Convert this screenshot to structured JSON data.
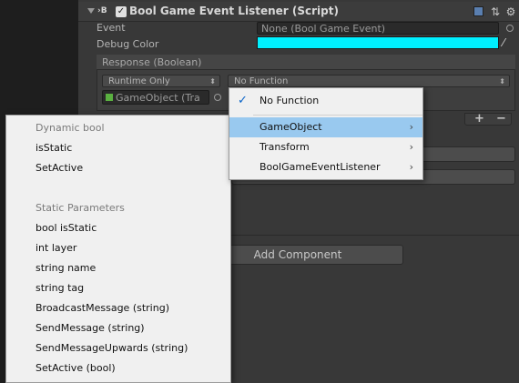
{
  "component": {
    "title": "Bool Game Event Listener (Script)",
    "enabled_mark": "✓",
    "script_icon_text": "›B"
  },
  "fields": {
    "event_label": "Event",
    "event_value": "None (Bool Game Event)",
    "debug_color_label": "Debug Color",
    "debug_color_value": "#00f0ff"
  },
  "response": {
    "title": "Response (Boolean)",
    "runtime_mode": "Runtime Only",
    "function": "No Function",
    "target_object": "GameObject (Tra",
    "plus": "+",
    "minus": "−"
  },
  "add_component_label": "Add Component",
  "right_menu": {
    "items": [
      {
        "label": "No Function",
        "checked": true,
        "has_submenu": false
      },
      {
        "label": "GameObject",
        "checked": false,
        "has_submenu": true,
        "highlighted": true
      },
      {
        "label": "Transform",
        "checked": false,
        "has_submenu": true
      },
      {
        "label": "BoolGameEventListener",
        "checked": false,
        "has_submenu": true
      }
    ],
    "check_glyph": "✓",
    "chevron_glyph": "›"
  },
  "left_menu": {
    "dynamic_header": "Dynamic bool",
    "dynamic_items": [
      "isStatic",
      "SetActive"
    ],
    "static_header": "Static Parameters",
    "static_items": [
      "bool isStatic",
      "int layer",
      "string name",
      "string tag",
      "BroadcastMessage (string)",
      "SendMessage (string)",
      "SendMessageUpwards (string)",
      "SetActive (bool)"
    ]
  },
  "colors": {
    "debug_color": "#00f0ff",
    "menu_highlight": "#99c9ef",
    "inspector_bg": "#383838"
  }
}
